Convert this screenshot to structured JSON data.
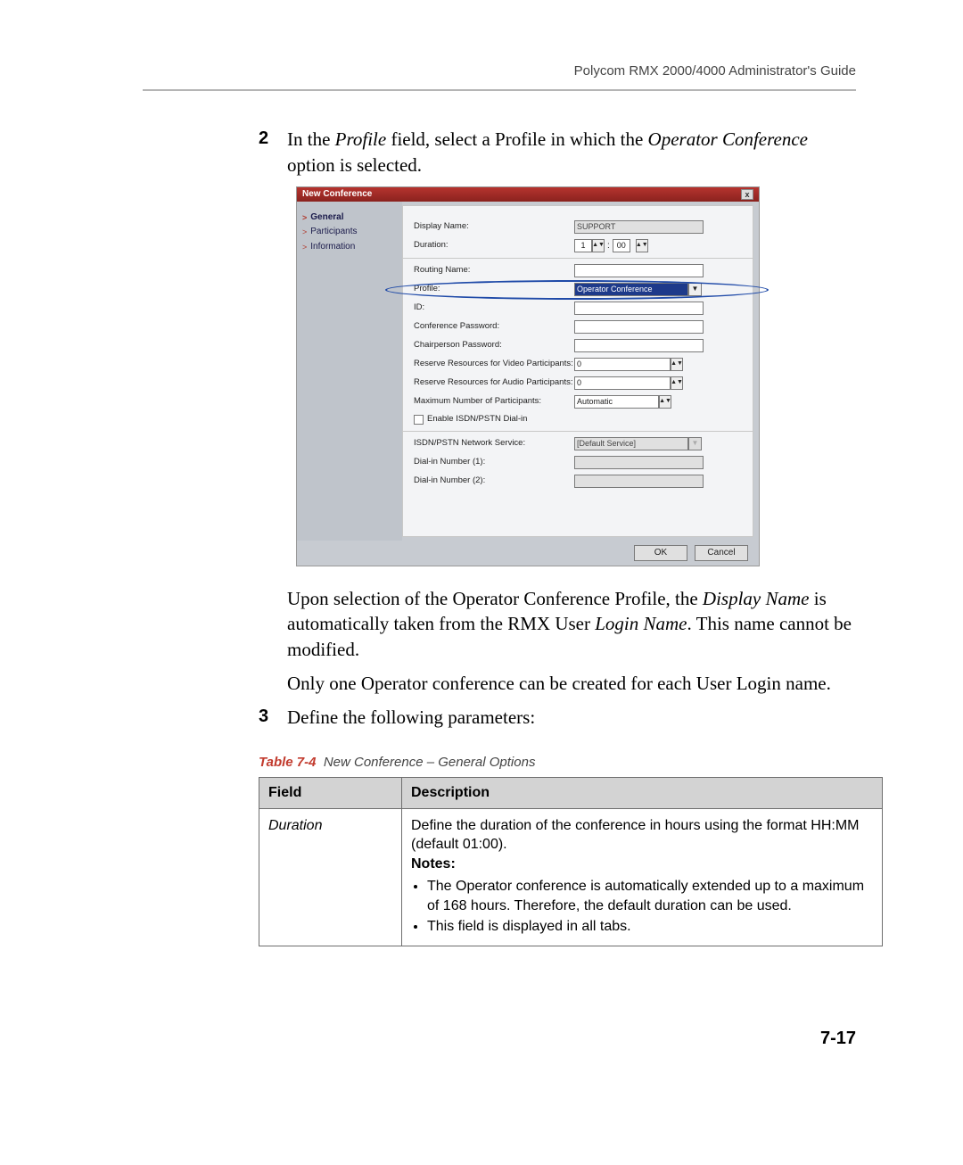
{
  "header": {
    "title": "Polycom RMX 2000/4000 Administrator's Guide"
  },
  "steps": {
    "two": {
      "num": "2",
      "text_before": "In the ",
      "profile": "Profile",
      "text_mid": " field, select a Profile in which the ",
      "opconf": "Operator Conference",
      "text_after": " option is selected."
    },
    "follow1_a": "Upon selection of the Operator Conference Profile, the ",
    "follow1_dn": "Display Name",
    "follow1_b": " is automatically taken from the RMX User ",
    "follow1_ln": "Login Name",
    "follow1_c": ". This name cannot be modified.",
    "follow2": "Only one Operator conference can be created for each User Login name.",
    "three": {
      "num": "3",
      "text": "Define the following parameters:"
    }
  },
  "dialog": {
    "title": "New Conference",
    "close": "x",
    "side": {
      "general": "General",
      "participants": "Participants",
      "information": "Information"
    },
    "labels": {
      "display_name": "Display Name:",
      "duration": "Duration:",
      "routing_name": "Routing Name:",
      "profile": "Profile:",
      "id": "ID:",
      "conf_pw": "Conference Password:",
      "chair_pw": "Chairperson Password:",
      "res_video": "Reserve Resources for Video Participants:",
      "res_audio": "Reserve Resources for Audio Participants:",
      "max_part": "Maximum Number of Participants:",
      "enable_isdn": "Enable ISDN/PSTN Dial-in",
      "isdn_svc": "ISDN/PSTN Network Service:",
      "dial1": "Dial-in Number (1):",
      "dial2": "Dial-in Number (2):"
    },
    "values": {
      "display_name": "SUPPORT",
      "dur_h": "1",
      "dur_sep": ":",
      "dur_m": "00",
      "profile": "Operator Conference",
      "res_video": "0",
      "res_audio": "0",
      "max_part": "Automatic",
      "isdn_svc": "[Default Service]"
    },
    "buttons": {
      "ok": "OK",
      "cancel": "Cancel"
    }
  },
  "table": {
    "caption_label": "Table 7-4",
    "caption_title": "New Conference – General Options",
    "head_field": "Field",
    "head_desc": "Description",
    "row1": {
      "field": "Duration",
      "desc_line1": "Define the duration of the conference in hours using the format HH:MM (default 01:00).",
      "notes_label": "Notes:",
      "bullet1": "The Operator conference is automatically extended up to a maximum of 168 hours. Therefore, the default duration can be used.",
      "bullet2": "This field is displayed in all tabs."
    }
  },
  "page_number": "7-17"
}
